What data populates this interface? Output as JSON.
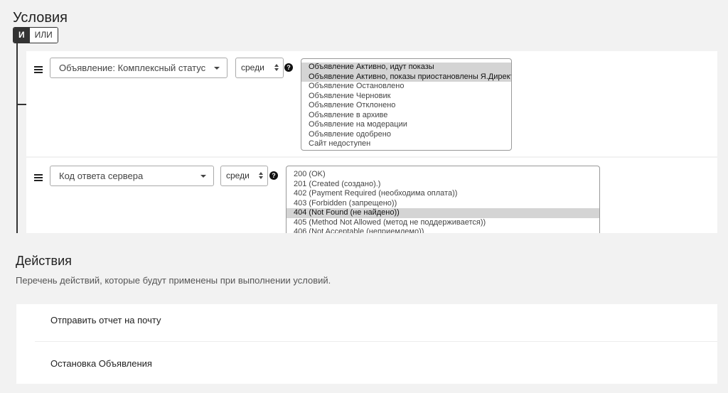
{
  "conditions": {
    "title": "Условия",
    "logic": {
      "and_label": "И",
      "or_label": "ИЛИ",
      "selected": "И"
    },
    "rows": [
      {
        "field": "Объявление: Комплексный статус",
        "operator": "среди",
        "help": "?",
        "options": [
          {
            "label": "Объявление Активно, идут показы",
            "selected": true
          },
          {
            "label": "Объявление Активно, показы приостановлены Я.Директ",
            "selected": true
          },
          {
            "label": "Объявление Остановлено",
            "selected": false
          },
          {
            "label": "Объявление Черновик",
            "selected": false
          },
          {
            "label": "Объявление Отклонено",
            "selected": false
          },
          {
            "label": "Объявление в архиве",
            "selected": false
          },
          {
            "label": "Объявление на модерации",
            "selected": false
          },
          {
            "label": "Объявление одобрено",
            "selected": false
          },
          {
            "label": "Сайт недоступен",
            "selected": false
          }
        ]
      },
      {
        "field": "Код ответа сервера",
        "operator": "среди",
        "help": "?",
        "options": [
          {
            "label": "200 (OK)",
            "selected": false
          },
          {
            "label": "201 (Created (создано).)",
            "selected": false
          },
          {
            "label": "402 (Payment Required (необходима оплата))",
            "selected": false
          },
          {
            "label": "403 (Forbidden (запрещено))",
            "selected": false
          },
          {
            "label": "404 (Not Found (не найдено))",
            "selected": true
          },
          {
            "label": "405 (Method Not Allowed (метод не поддерживается))",
            "selected": false
          },
          {
            "label": "406 (Not Acceptable (неприемлемо))",
            "selected": false
          }
        ]
      }
    ]
  },
  "actions": {
    "title": "Действия",
    "description": "Перечень действий, которые будут применены при выполнении условий.",
    "items": [
      "Отправить отчет на почту",
      "Остановка Объявления"
    ]
  }
}
